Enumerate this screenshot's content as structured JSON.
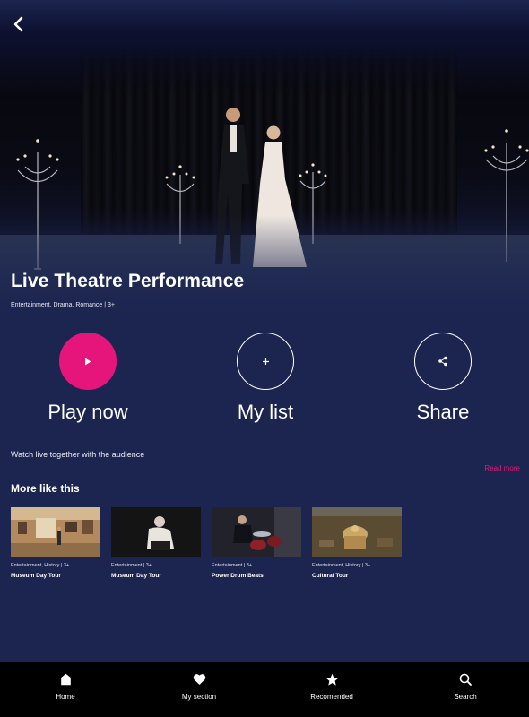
{
  "hero": {
    "title": "Live Theatre Performance",
    "meta": "Entertainment, Drama, Romance | 3+"
  },
  "actions": {
    "play": {
      "label": "Play now",
      "icon": "play-icon"
    },
    "my_list": {
      "label": "My list",
      "icon": "plus-icon"
    },
    "share": {
      "label": "Share",
      "icon": "share-icon"
    }
  },
  "description": "Watch live together with the audience",
  "read_more": "Read more",
  "more_like_this": {
    "title": "More like this",
    "items": [
      {
        "meta": "Entertainment, History | 3+",
        "title": "Museum Day Tour"
      },
      {
        "meta": "Entertainment | 3+",
        "title": "Museum Day Tour"
      },
      {
        "meta": "Entertainment | 3+",
        "title": "Power Drum Beats"
      },
      {
        "meta": "Entertainment, History | 3+",
        "title": "Cultural Tour"
      }
    ]
  },
  "nav": {
    "items": [
      {
        "label": "Home",
        "icon": "home-icon"
      },
      {
        "label": "My section",
        "icon": "heart-icon"
      },
      {
        "label": "Recomended",
        "icon": "star-icon"
      },
      {
        "label": "Search",
        "icon": "search-icon"
      }
    ]
  },
  "colors": {
    "background": "#1c2550",
    "accent": "#e6157b",
    "nav_background": "#000000"
  }
}
